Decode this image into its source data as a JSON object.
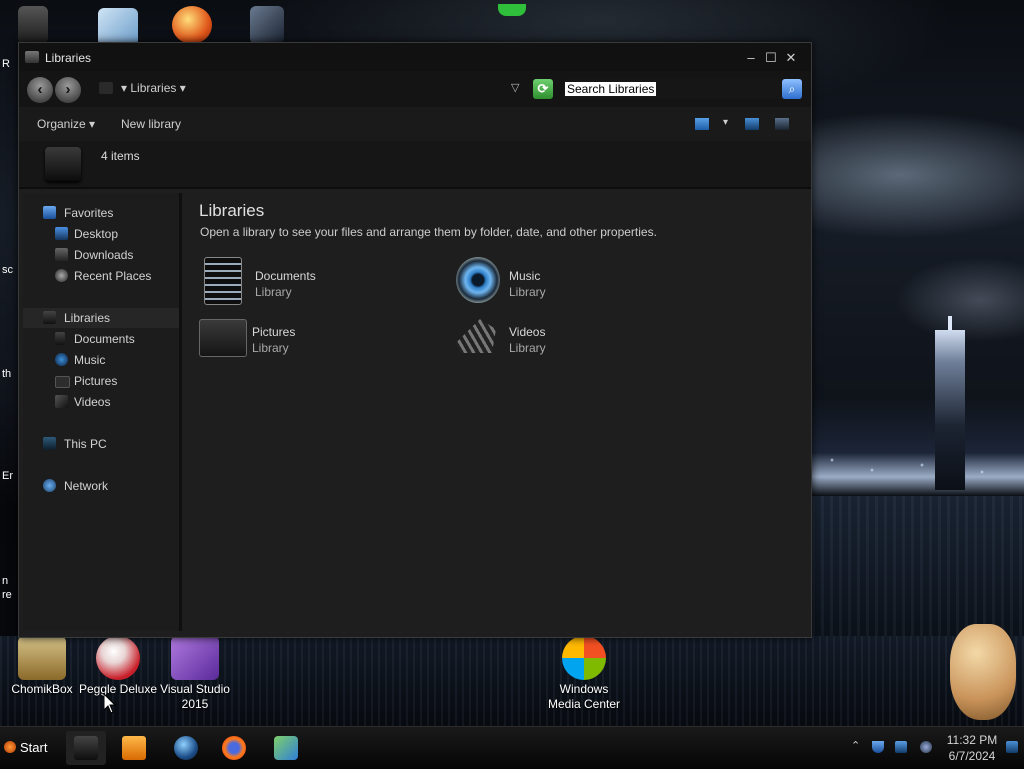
{
  "window": {
    "title": "Libraries",
    "breadcrumb": "Libraries",
    "search_value": "Search Libraries",
    "toolbar": {
      "organize": "Organize",
      "new_library": "New library"
    },
    "item_count": "4 items",
    "controls": {
      "minimize": "–",
      "maximize": "☐",
      "close": "✕"
    }
  },
  "sidebar": {
    "favorites": {
      "label": "Favorites",
      "items": [
        "Desktop",
        "Downloads",
        "Recent Places"
      ]
    },
    "libraries": {
      "label": "Libraries",
      "items": [
        "Documents",
        "Music",
        "Pictures",
        "Videos"
      ]
    },
    "this_pc": "This PC",
    "network": "Network"
  },
  "content": {
    "title": "Libraries",
    "description": "Open a library to see your files and arrange them by folder, date, and other properties.",
    "libraries": [
      {
        "name": "Documents",
        "type": "Library",
        "icon": "documents-icon"
      },
      {
        "name": "Music",
        "type": "Library",
        "icon": "music-icon"
      },
      {
        "name": "Pictures",
        "type": "Library",
        "icon": "pictures-icon"
      },
      {
        "name": "Videos",
        "type": "Library",
        "icon": "videos-icon"
      }
    ]
  },
  "desktop": {
    "icons": [
      {
        "label": "ChomikBox"
      },
      {
        "label": "Peggle Deluxe"
      },
      {
        "label": "Visual Studio 2015"
      },
      {
        "label": "Windows Media Center"
      }
    ],
    "edge_text": [
      "R",
      "sc",
      "th",
      "Er",
      "n",
      "re"
    ]
  },
  "taskbar": {
    "start": "Start",
    "time": "11:32 PM",
    "date": "6/7/2024"
  },
  "colors": {
    "window_bg": "#1e1e1e",
    "titlebar_bg": "#111111",
    "text": "#d6d6d6",
    "accent_blue": "#2f6fcf",
    "refresh_green": "#2f8f2f"
  }
}
